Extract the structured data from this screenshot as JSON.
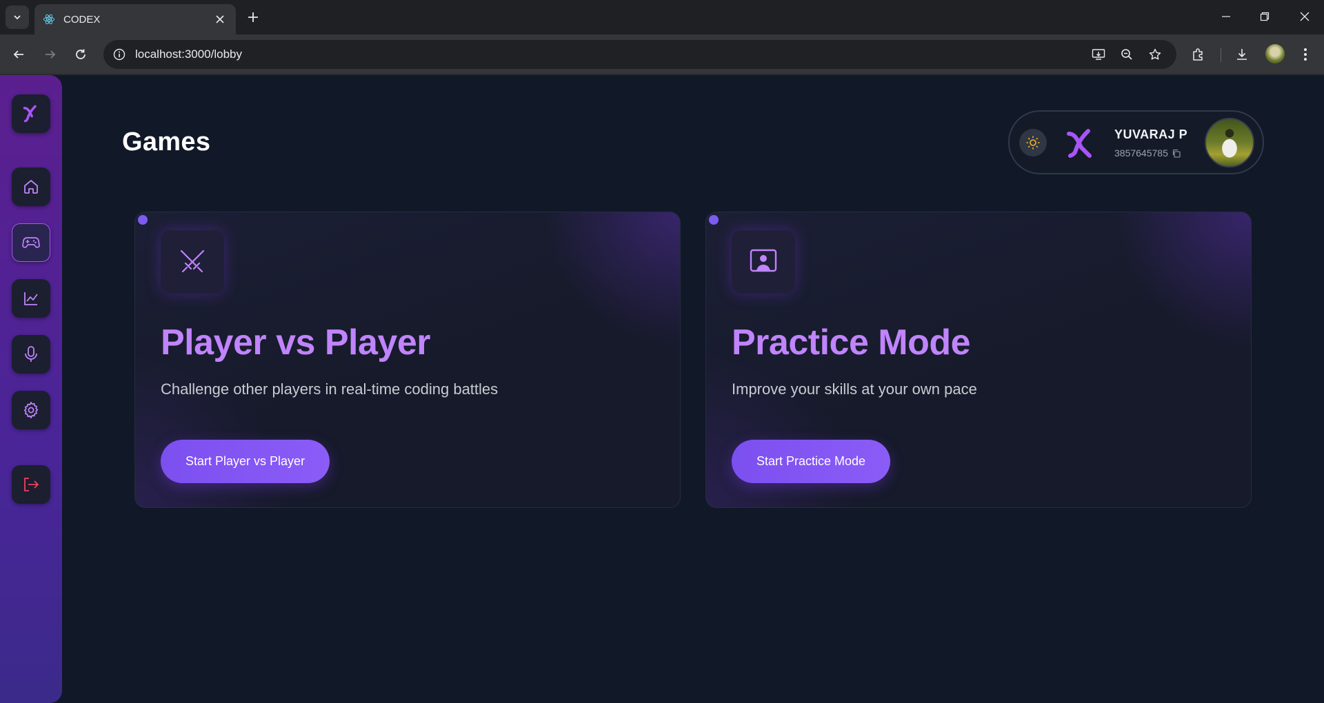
{
  "browser": {
    "tab_title": "CODEX",
    "url": "localhost:3000/lobby"
  },
  "sidebar": {
    "items": [
      {
        "name": "logo",
        "icon": "codex-logo-icon",
        "active": false
      },
      {
        "name": "home",
        "icon": "home-icon",
        "active": false
      },
      {
        "name": "games",
        "icon": "gamepad-icon",
        "active": true
      },
      {
        "name": "stats",
        "icon": "chart-icon",
        "active": false
      },
      {
        "name": "voice",
        "icon": "microphone-icon",
        "active": false
      },
      {
        "name": "settings",
        "icon": "gear-icon",
        "active": false
      },
      {
        "name": "logout",
        "icon": "logout-icon",
        "active": false
      }
    ]
  },
  "header": {
    "title": "Games"
  },
  "profile": {
    "name": "YUVARAJ P",
    "id": "3857645785"
  },
  "cards": [
    {
      "icon": "crossed-swords-icon",
      "title": "Player vs Player",
      "description": "Challenge other players in real-time coding battles",
      "button": "Start Player vs Player"
    },
    {
      "icon": "user-screen-icon",
      "title": "Practice Mode",
      "description": "Improve your skills at your own pace",
      "button": "Start Practice Mode"
    }
  ],
  "colors": {
    "accent": "#8b5cf6",
    "title_purple": "#c084fc",
    "background": "#111827",
    "sidebar": "#4a2598",
    "sun": "#f5b52b",
    "logout": "#f43f5e"
  }
}
